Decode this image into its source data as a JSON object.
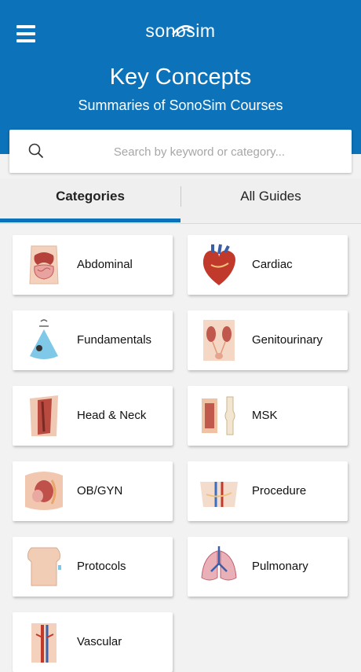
{
  "header": {
    "logo_text": "sonosim",
    "title": "Key Concepts",
    "subtitle": "Summaries of SonoSim Courses"
  },
  "search": {
    "placeholder": "Search by keyword or category..."
  },
  "tabs": [
    {
      "label": "Categories",
      "active": true
    },
    {
      "label": "All Guides",
      "active": false
    }
  ],
  "categories": [
    {
      "label": "Abdominal",
      "icon": "abdomen-anatomy-icon"
    },
    {
      "label": "Cardiac",
      "icon": "heart-anatomy-icon"
    },
    {
      "label": "Fundamentals",
      "icon": "ultrasound-probe-icon"
    },
    {
      "label": "Genitourinary",
      "icon": "kidney-anatomy-icon"
    },
    {
      "label": "Head & Neck",
      "icon": "neck-anatomy-icon"
    },
    {
      "label": "MSK",
      "icon": "knee-anatomy-icon"
    },
    {
      "label": "OB/GYN",
      "icon": "pelvis-anatomy-icon"
    },
    {
      "label": "Procedure",
      "icon": "procedure-anatomy-icon"
    },
    {
      "label": "Protocols",
      "icon": "torso-anatomy-icon"
    },
    {
      "label": "Pulmonary",
      "icon": "lungs-anatomy-icon"
    },
    {
      "label": "Vascular",
      "icon": "vascular-anatomy-icon"
    }
  ],
  "colors": {
    "header_bg": "#0c72b9",
    "accent": "#0c72b9"
  }
}
